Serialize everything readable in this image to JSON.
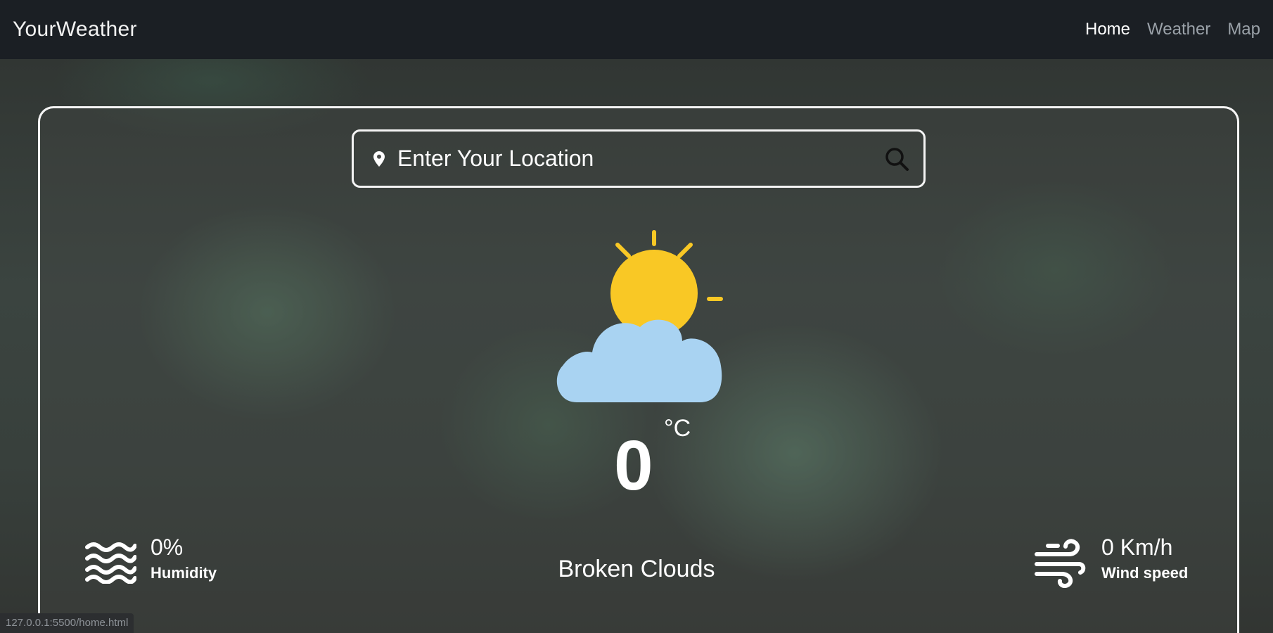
{
  "navbar": {
    "brand": "YourWeather",
    "links": [
      {
        "label": "Home",
        "active": true
      },
      {
        "label": "Weather",
        "active": false
      },
      {
        "label": "Map",
        "active": false
      }
    ]
  },
  "search": {
    "placeholder": "Enter Your Location"
  },
  "weather": {
    "icon": "partly-cloudy-sun-icon",
    "temperature": "0",
    "unit": "°C",
    "description": "Broken Clouds"
  },
  "humidity": {
    "value": "0%",
    "label": "Humidity",
    "icon": "waves-icon"
  },
  "wind": {
    "value": "0 Km/h",
    "label": "Wind speed",
    "icon": "wind-icon"
  },
  "status_bar": {
    "url": "127.0.0.1:5500/home.html"
  },
  "colors": {
    "navbar_bg": "#1b1f24",
    "sun": "#f9c825",
    "cloud": "#a9d3f2",
    "border": "#f4f4f4"
  }
}
